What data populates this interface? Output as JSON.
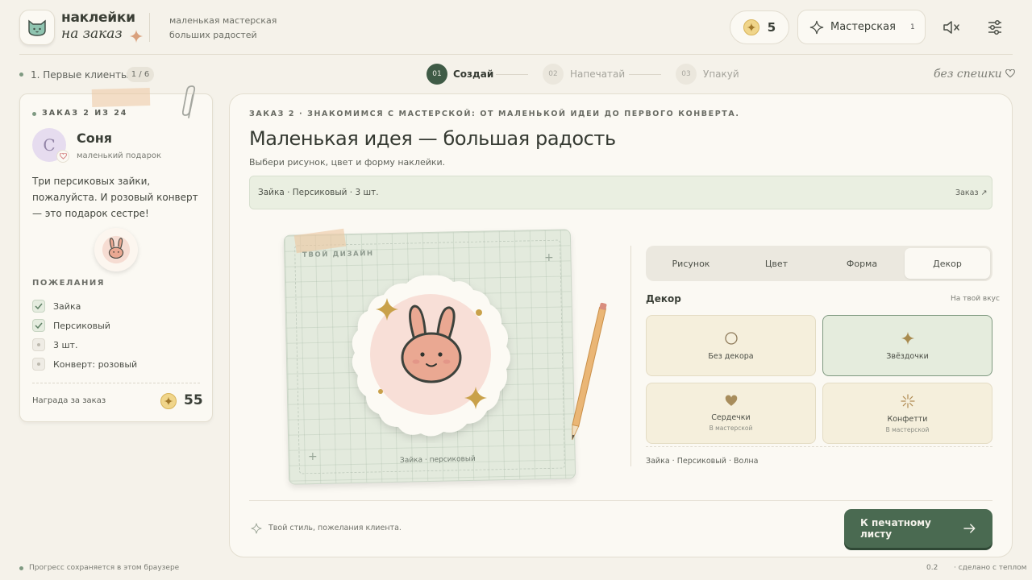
{
  "brand": {
    "line1": "наклейки",
    "line2": "на заказ",
    "tagline_1": "маленькая мастерская",
    "tagline_2": "больших радостей",
    "logo_icon": "cat-icon"
  },
  "header": {
    "coins": "5",
    "workshop_label": "Мастерская",
    "workshop_badge": "1",
    "mute_icon": "speaker-muted-icon",
    "settings_icon": "sliders-icon"
  },
  "progress": {
    "level_label": "1. Первые клиенты",
    "level_counter": "1 / 6",
    "steps": [
      {
        "num": "01",
        "label": "Создай",
        "active": true
      },
      {
        "num": "02",
        "label": "Напечатай",
        "active": false
      },
      {
        "num": "03",
        "label": "Упакуй",
        "active": false
      }
    ],
    "pace_label": "без спешки"
  },
  "order": {
    "number": "ЗАКАЗ 2 ИЗ 24",
    "client_initial": "С",
    "client_name": "Соня",
    "client_subtitle": "маленький подарок",
    "message": "Три персиковых зайки, пожалуйста. И розовый конверт — это подарок сестре!",
    "wishes_title": "ПОЖЕЛАНИЯ",
    "wishes": [
      {
        "label": "Зайка",
        "done": true
      },
      {
        "label": "Персиковый",
        "done": true
      },
      {
        "label": "3 шт.",
        "done": false
      },
      {
        "label": "Конверт: розовый",
        "done": false
      }
    ],
    "reward_label": "Награда за заказ",
    "reward_value": "55"
  },
  "main": {
    "kicker": "ЗАКАЗ 2 · ЗНАКОМИМСЯ С МАСТЕРСКОЙ: ОТ МАЛЕНЬКОЙ ИДЕИ ДО ПЕРВОГО КОНВЕРТА.",
    "title": "Маленькая идея — большая радость",
    "subtitle": "Выбери рисунок, цвет и форму наклейки.",
    "summary": "Зайка · Персиковый · 3 шт.",
    "summary_link": "Заказ ↗",
    "canvas_label": "ТВОЙ ДИЗАЙН",
    "canvas_caption": "Зайка · персиковый",
    "tabs": [
      "Рисунок",
      "Цвет",
      "Форма",
      "Декор"
    ],
    "active_tab": 3,
    "decor_title": "Декор",
    "decor_hint": "На твой вкус",
    "decor_options": [
      {
        "label": "Без декора",
        "sub": "",
        "icon": "circle-outline-icon",
        "selected": false
      },
      {
        "label": "Звёздочки",
        "sub": "",
        "icon": "sparkle-icon",
        "selected": true
      },
      {
        "label": "Сердечки",
        "sub": "В мастерской",
        "icon": "heart-icon",
        "selected": false
      },
      {
        "label": "Конфетти",
        "sub": "В мастерской",
        "icon": "confetti-icon",
        "selected": false
      }
    ],
    "decor_summary": "Зайка · Персиковый · Волна",
    "footer_hint": "Твой стиль, пожелания клиента.",
    "primary_button": "К печатному листу"
  },
  "status": {
    "saved_text": "Прогресс сохраняется в этом браузере",
    "version": "0.2",
    "made_with": "·   сделано с теплом"
  },
  "colors": {
    "accent_green": "#4a6a51",
    "gold": "#c9a14a",
    "peach": "#eaa892",
    "background": "#f5f2ea"
  }
}
